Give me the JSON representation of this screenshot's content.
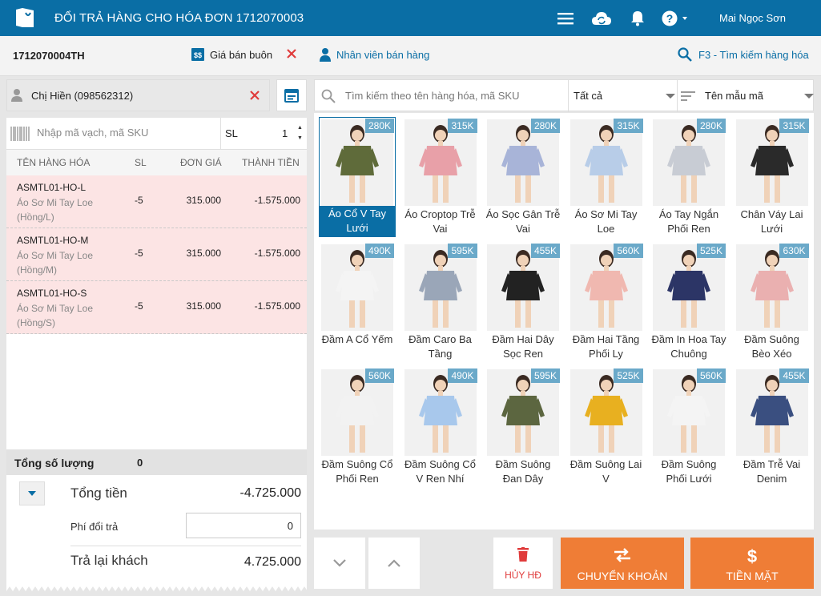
{
  "header": {
    "title": "ĐỔI TRẢ HÀNG CHO HÓA ĐƠN 1712070003",
    "user": "Mai Ngọc Sơn",
    "icons": [
      "menu-icon",
      "cloud-sync-icon",
      "bell-icon",
      "help-icon"
    ]
  },
  "toolbar": {
    "order_code": "1712070004TH",
    "price_mode": "Giá bán buôn",
    "staff_label": "Nhân viên bán hàng",
    "search_shortcut": "F3 - Tìm kiếm hàng hóa"
  },
  "customer": {
    "name": "Chị Hiền (098562312)"
  },
  "barcode": {
    "placeholder": "Nhập mã vạch, mã SKU",
    "qty_label": "SL",
    "qty_value": "1"
  },
  "grid": {
    "headers": [
      "TÊN HÀNG HÓA",
      "SL",
      "ĐƠN GIÁ",
      "THÀNH TIỀN"
    ],
    "rows": [
      {
        "code": "ASMTL01-HO-L",
        "name": "Áo Sơ Mi Tay Loe (Hồng/L)",
        "qty": "-5",
        "price": "315.000",
        "total": "-1.575.000"
      },
      {
        "code": "ASMTL01-HO-M",
        "name": "Áo Sơ Mi Tay Loe (Hồng/M)",
        "qty": "-5",
        "price": "315.000",
        "total": "-1.575.000"
      },
      {
        "code": "ASMTL01-HO-S",
        "name": "Áo Sơ Mi Tay Loe (Hồng/S)",
        "qty": "-5",
        "price": "315.000",
        "total": "-1.575.000"
      }
    ]
  },
  "summary": {
    "qty_label": "Tổng số lượng",
    "qty_value": "0",
    "total_label": "Tổng tiền",
    "total_value": "-4.725.000",
    "fee_label": "Phí đổi trả",
    "fee_value": "0",
    "refund_label": "Trả lại khách",
    "refund_value": "4.725.000"
  },
  "search": {
    "placeholder": "Tìm kiếm theo tên hàng hóa, mã SKU",
    "filter": "Tất cả",
    "sort": "Tên mẫu mã"
  },
  "products": [
    {
      "name": "Áo Cổ V Tay Lưới",
      "price": "280K",
      "color": "#5f6b3a",
      "skin": "#f0d2b8",
      "active": true
    },
    {
      "name": "Áo Croptop Trễ Vai",
      "price": "315K",
      "color": "#e8a0a8",
      "skin": "#f0d2b8"
    },
    {
      "name": "Áo Sọc Gân Trễ Vai",
      "price": "280K",
      "color": "#a8b4d8",
      "skin": "#f0d2b8"
    },
    {
      "name": "Áo Sơ Mi Tay Loe",
      "price": "315K",
      "color": "#b8cde8",
      "skin": "#f0d2b8"
    },
    {
      "name": "Áo Tay Ngắn Phối Ren",
      "price": "280K",
      "color": "#c8ccd4",
      "skin": "#f0d2b8"
    },
    {
      "name": "Chân Váy Lai Lưới",
      "price": "315K",
      "color": "#2a2a2a",
      "skin": "#f0d2b8"
    },
    {
      "name": "Đầm A Cổ Yếm",
      "price": "490K",
      "color": "#f4f4f4",
      "skin": "#f0d2b8"
    },
    {
      "name": "Đầm Caro Ba Tầng",
      "price": "595K",
      "color": "#9aa6b8",
      "skin": "#f0d2b8"
    },
    {
      "name": "Đầm Hai Dây Sọc Ren",
      "price": "455K",
      "color": "#222222",
      "skin": "#f0d2b8"
    },
    {
      "name": "Đầm Hai Tầng Phối Ly",
      "price": "560K",
      "color": "#f0b8b0",
      "skin": "#f0d2b8"
    },
    {
      "name": "Đầm In Hoa Tay Chuông",
      "price": "525K",
      "color": "#2c3566",
      "skin": "#f0d2b8"
    },
    {
      "name": "Đầm Suông Bèo Xéo",
      "price": "630K",
      "color": "#eab0b0",
      "skin": "#f0d2b8"
    },
    {
      "name": "Đầm Suông Cổ Phối Ren",
      "price": "560K",
      "color": "#f2f2f2",
      "skin": "#f0d2b8"
    },
    {
      "name": "Đầm Suông Cổ V Ren Nhí",
      "price": "490K",
      "color": "#a8c8ec",
      "skin": "#f0d2b8"
    },
    {
      "name": "Đầm Suông Đan Dây",
      "price": "595K",
      "color": "#5c6640",
      "skin": "#f0d2b8"
    },
    {
      "name": "Đầm Suông Lai V",
      "price": "525K",
      "color": "#e8b020",
      "skin": "#f0d2b8"
    },
    {
      "name": "Đầm Suông Phối Lưới",
      "price": "560K",
      "color": "#f4f4f4",
      "skin": "#f0d2b8"
    },
    {
      "name": "Đầm Trễ Vai Denim",
      "price": "455K",
      "color": "#3a4f80",
      "skin": "#f0d2b8"
    }
  ],
  "actions": {
    "cancel": "HỦY HĐ",
    "transfer": "CHUYỂN KHOẢN",
    "cash": "TIỀN MẶT"
  },
  "colors": {
    "primary": "#0a6ea5",
    "accent": "#ef7d36",
    "danger": "#e03b3b",
    "row_highlight": "#fce4e4"
  }
}
